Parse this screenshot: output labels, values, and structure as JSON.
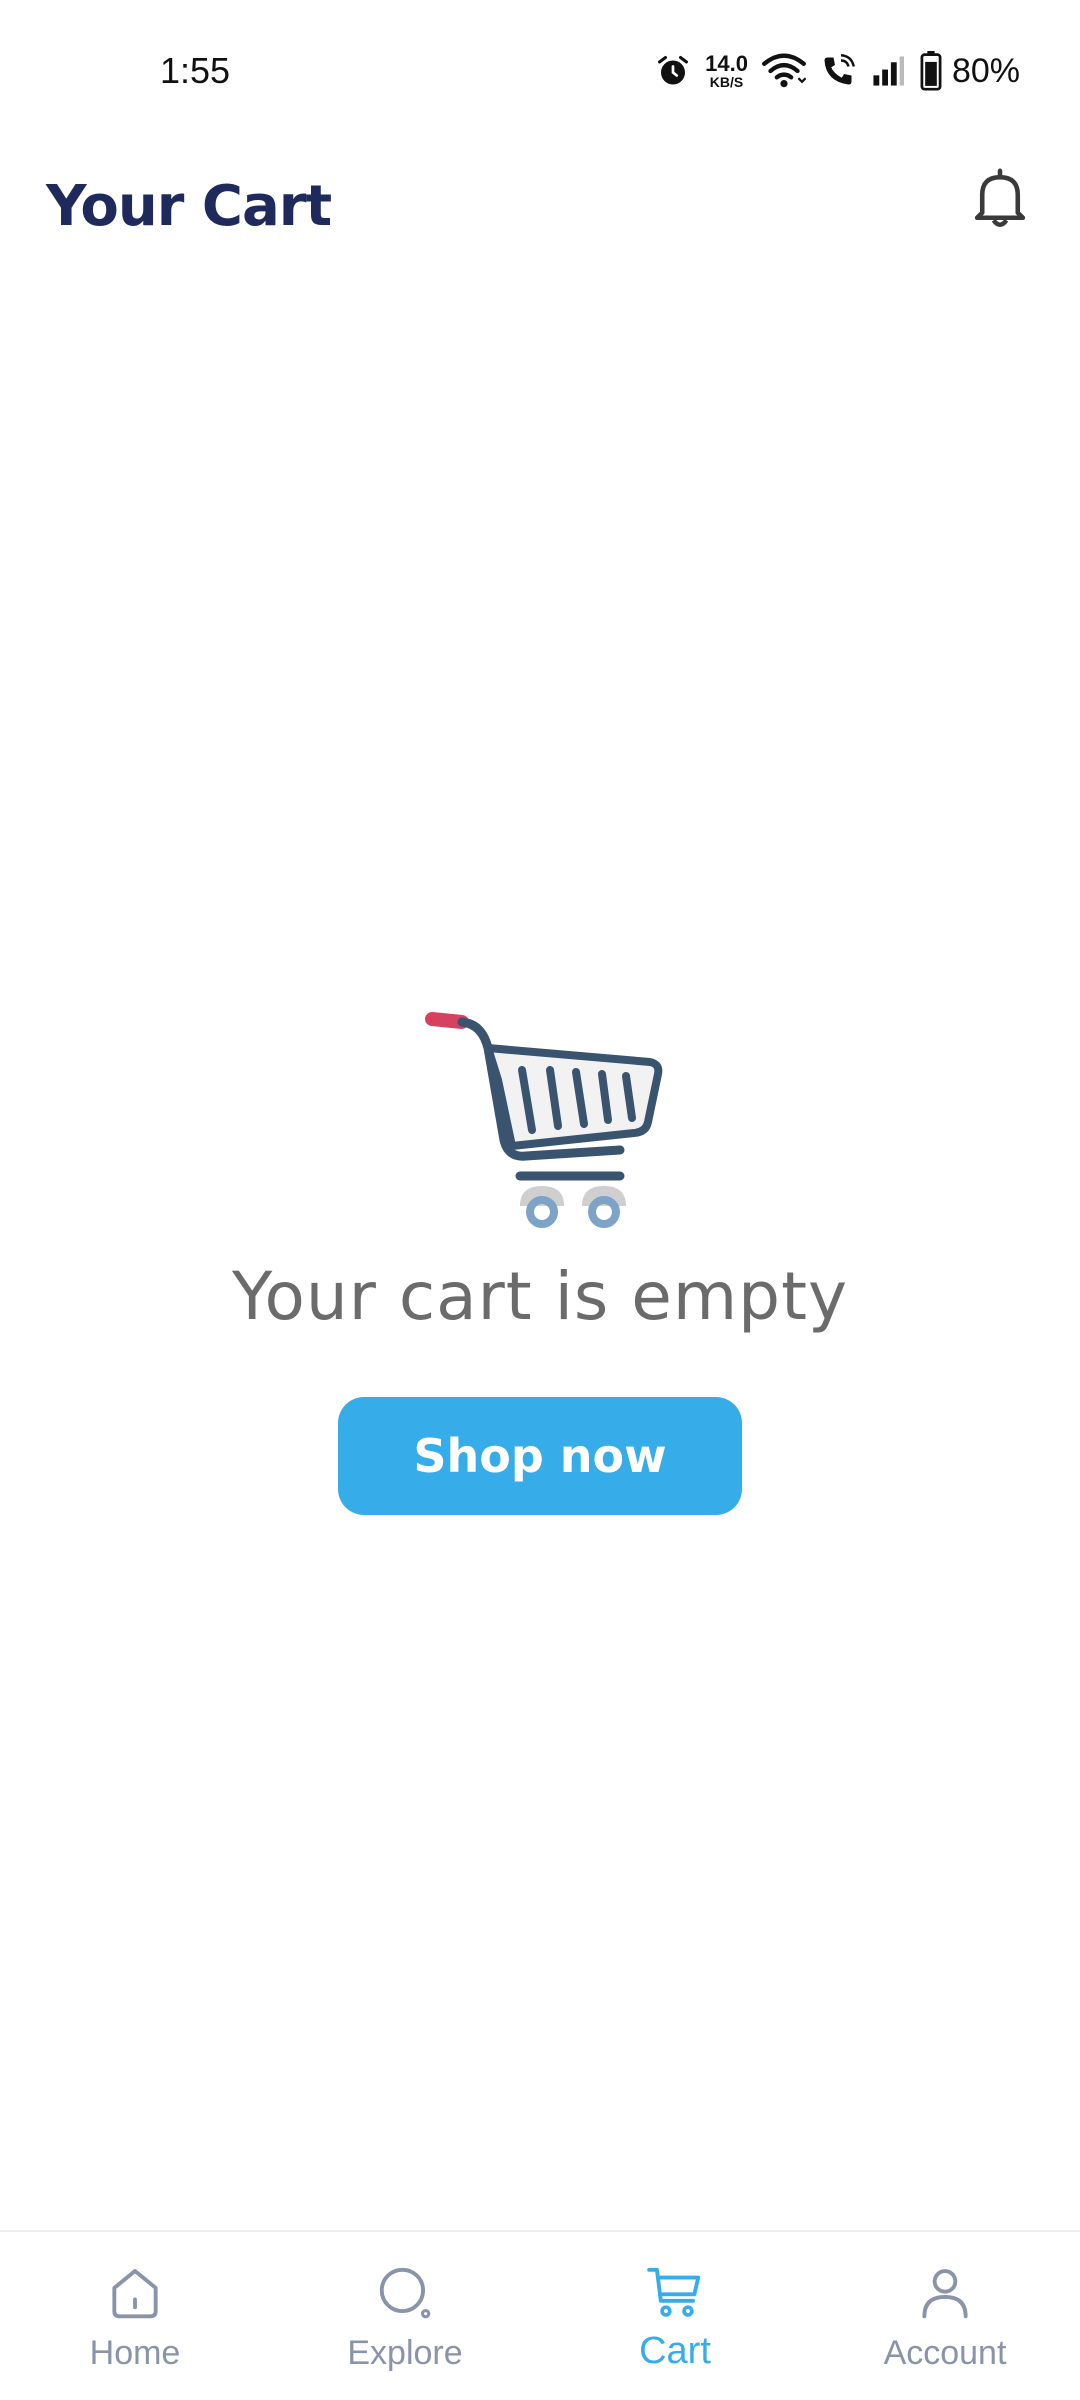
{
  "status_bar": {
    "time": "1:55",
    "net_speed_value": "14.0",
    "net_speed_unit": "KB/S",
    "battery": "80%",
    "icons": [
      "alarm-icon",
      "wifi-icon",
      "wifi-calling-icon",
      "signal-icon",
      "battery-icon"
    ]
  },
  "header": {
    "title": "Your Cart",
    "notification_icon": "bell-icon"
  },
  "empty_state": {
    "illustration": "shopping-cart-icon",
    "message": "Your cart is empty",
    "button_label": "Shop now"
  },
  "bottom_nav": {
    "items": [
      {
        "label": "Home",
        "icon": "home-icon",
        "active": false
      },
      {
        "label": "Explore",
        "icon": "search-icon",
        "active": false
      },
      {
        "label": "Cart",
        "icon": "cart-icon",
        "active": true
      },
      {
        "label": "Account",
        "icon": "user-icon",
        "active": false
      }
    ]
  },
  "colors": {
    "title": "#1f2a5c",
    "accent": "#36ade8",
    "inactive": "#8a93a8",
    "message": "#6b6b6b",
    "cart_handle": "#d6415f",
    "cart_body": "#3a5470",
    "cart_wheels": "#7ea3c8"
  }
}
